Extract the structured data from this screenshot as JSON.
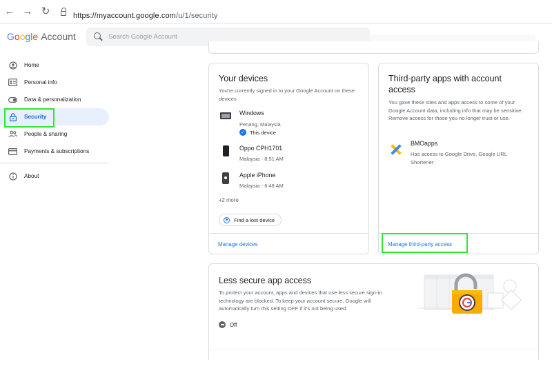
{
  "browser": {
    "url_host": "https://myaccount.google.com",
    "url_path": "/u/1/security"
  },
  "header": {
    "logo_letters": [
      "G",
      "o",
      "o",
      "g",
      "l",
      "e"
    ],
    "logo_suffix": "Account",
    "search_placeholder": "Search Google Account"
  },
  "sidebar": {
    "items": [
      {
        "label": "Home",
        "icon": "home-icon"
      },
      {
        "label": "Personal info",
        "icon": "id-card-icon"
      },
      {
        "label": "Data & personalization",
        "icon": "toggle-icon"
      },
      {
        "label": "Security",
        "icon": "lock-icon",
        "active": true
      },
      {
        "label": "People & sharing",
        "icon": "people-icon"
      },
      {
        "label": "Payments & subscriptions",
        "icon": "card-icon"
      }
    ],
    "about": {
      "label": "About",
      "icon": "info-icon"
    }
  },
  "devices_card": {
    "title": "Your devices",
    "description": "You're currently signed in to your Google Account on these devices",
    "devices": [
      {
        "name": "Windows",
        "location": "Penang, Malaysia",
        "status": "This device"
      },
      {
        "name": "Oppo CPH1701",
        "location": "Malaysia - 8:51 AM"
      },
      {
        "name": "Apple iPhone",
        "location": "Malaysia - 6:48 AM"
      }
    ],
    "more": "+2 more",
    "find_button": "Find a lost device",
    "footer_link": "Manage devices"
  },
  "third_party_card": {
    "title": "Third-party apps with account access",
    "description": "You gave these sites and apps access to some of your Google Account data, including info that may be sensitive. Remove access for those you no longer trust or use.",
    "app": {
      "name": "BMOapps",
      "access": "Has access to Google Drive, Google URL Shortener"
    },
    "footer_link": "Manage third-party access"
  },
  "less_secure_card": {
    "title": "Less secure app access",
    "description": "To protect your account, apps and devices that use less secure sign-in technology are blocked. To keep your account secure, Google will automatically turn this setting OFF if it's not being used.",
    "status": "Off"
  },
  "colors": {
    "accent_blue": "#1a73e8",
    "active_bg": "#e8f0fe",
    "highlight_green": "#2ee82e"
  }
}
